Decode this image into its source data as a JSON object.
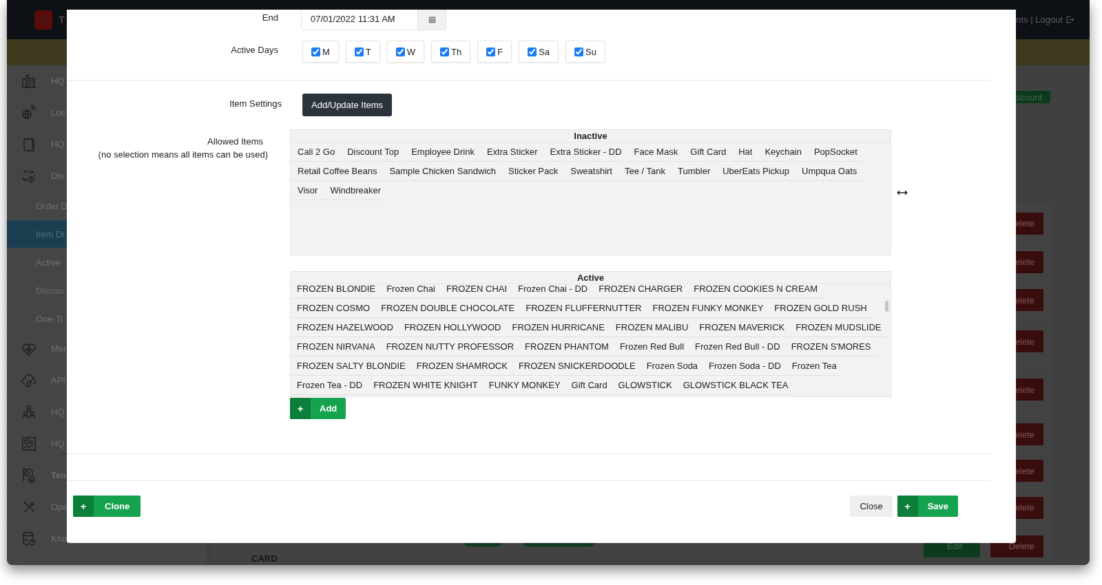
{
  "header": {
    "logo_text": "T",
    "links": "nts | Logout"
  },
  "sidebar": {
    "items": [
      {
        "label": "HQ",
        "kind": "main",
        "selected": false,
        "emphasized": false
      },
      {
        "label": "Loc",
        "kind": "main",
        "selected": false,
        "emphasized": false
      },
      {
        "label": "HQ",
        "kind": "main",
        "selected": false,
        "emphasized": false
      },
      {
        "label": "Dis",
        "kind": "main",
        "selected": false,
        "emphasized": false
      },
      {
        "label": "Order D",
        "kind": "sub",
        "selected": false,
        "emphasized": false
      },
      {
        "label": "Item Di",
        "kind": "sub",
        "selected": true,
        "emphasized": false
      },
      {
        "label": "Active",
        "kind": "sub",
        "selected": false,
        "emphasized": false
      },
      {
        "label": "Discou",
        "kind": "sub",
        "selected": false,
        "emphasized": false
      },
      {
        "label": "One-Ti",
        "kind": "sub",
        "selected": false,
        "emphasized": false
      },
      {
        "label": "Mer",
        "kind": "main",
        "selected": false,
        "emphasized": false
      },
      {
        "label": "API",
        "kind": "main",
        "selected": false,
        "emphasized": false
      },
      {
        "label": "HQ",
        "kind": "main",
        "selected": false,
        "emphasized": false
      },
      {
        "label": "HQ",
        "kind": "main",
        "selected": false,
        "emphasized": false
      },
      {
        "label": "Tem",
        "kind": "main",
        "selected": false,
        "emphasized": true
      },
      {
        "label": "Ope",
        "kind": "main",
        "selected": false,
        "emphasized": false
      },
      {
        "label": "Kno",
        "kind": "main",
        "selected": false,
        "emphasized": false
      }
    ]
  },
  "content": {
    "top_button": "scount",
    "rows": [
      {
        "delete": "elete"
      },
      {
        "delete": "elete"
      },
      {
        "delete": "elete"
      },
      {
        "delete": "elete"
      },
      {
        "delete": "elete"
      },
      {
        "delete": "elete"
      },
      {
        "delete": "elete"
      },
      {
        "delete": "elete"
      },
      {
        "name": "CARD",
        "edit": "Edit",
        "delete": "Delete"
      }
    ]
  },
  "modal": {
    "end": {
      "label": "End",
      "value": "07/01/2022 11:31 AM"
    },
    "active_days": {
      "label": "Active Days",
      "days": [
        {
          "label": "M",
          "checked": true
        },
        {
          "label": "T",
          "checked": true
        },
        {
          "label": "W",
          "checked": true
        },
        {
          "label": "Th",
          "checked": true
        },
        {
          "label": "F",
          "checked": true
        },
        {
          "label": "Sa",
          "checked": true
        },
        {
          "label": "Su",
          "checked": true
        }
      ]
    },
    "item_settings": {
      "label": "Item Settings",
      "button": "Add/Update Items"
    },
    "allowed_items": {
      "label": "Allowed Items",
      "hint": "(no selection means all items can be used)",
      "inactive": {
        "title": "Inactive",
        "items": [
          "Cali 2 Go",
          "Discount Top",
          "Employee Drink",
          "Extra Sticker",
          "Extra Sticker - DD",
          "Face Mask",
          "Gift Card",
          "Hat",
          "Keychain",
          "PopSocket",
          "Retail Coffee Beans",
          "Sample Chicken Sandwich",
          "Sticker Pack",
          "Sweatshirt",
          "Tee / Tank",
          "Tumbler",
          "UberEats Pickup",
          "Umpqua Oats",
          "Visor",
          "Windbreaker"
        ]
      },
      "active": {
        "title": "Active",
        "items": [
          "FROZEN BLONDIE",
          "Frozen Chai",
          "FROZEN CHAI",
          "Frozen Chai - DD",
          "FROZEN CHARGER",
          "FROZEN COOKIES N CREAM",
          "FROZEN COSMO",
          "FROZEN DOUBLE CHOCOLATE",
          "FROZEN FLUFFERNUTTER",
          "FROZEN FUNKY MONKEY",
          "FROZEN GOLD RUSH",
          "FROZEN HAZELWOOD",
          "FROZEN HOLLYWOOD",
          "FROZEN HURRICANE",
          "FROZEN MALIBU",
          "FROZEN MAVERICK",
          "FROZEN MUDSLIDE",
          "FROZEN NIRVANA",
          "FROZEN NUTTY PROFESSOR",
          "FROZEN PHANTOM",
          "Frozen Red Bull",
          "Frozen Red Bull - DD",
          "FROZEN S'MORES",
          "FROZEN SALTY BLONDIE",
          "FROZEN SHAMROCK",
          "FROZEN SNICKERDOODLE",
          "Frozen Soda",
          "Frozen Soda - DD",
          "Frozen Tea",
          "Frozen Tea - DD",
          "FROZEN WHITE KNIGHT",
          "FUNKY MONKEY",
          "Gift Card",
          "GLOWSTICK",
          "GLOWSTICK BLACK TEA"
        ]
      },
      "add_button": {
        "glyph": "+",
        "label": "Add"
      }
    },
    "footer": {
      "clone": {
        "glyph": "+",
        "label": "Clone"
      },
      "close": "Close",
      "save": {
        "glyph": "+",
        "label": "Save"
      }
    }
  }
}
